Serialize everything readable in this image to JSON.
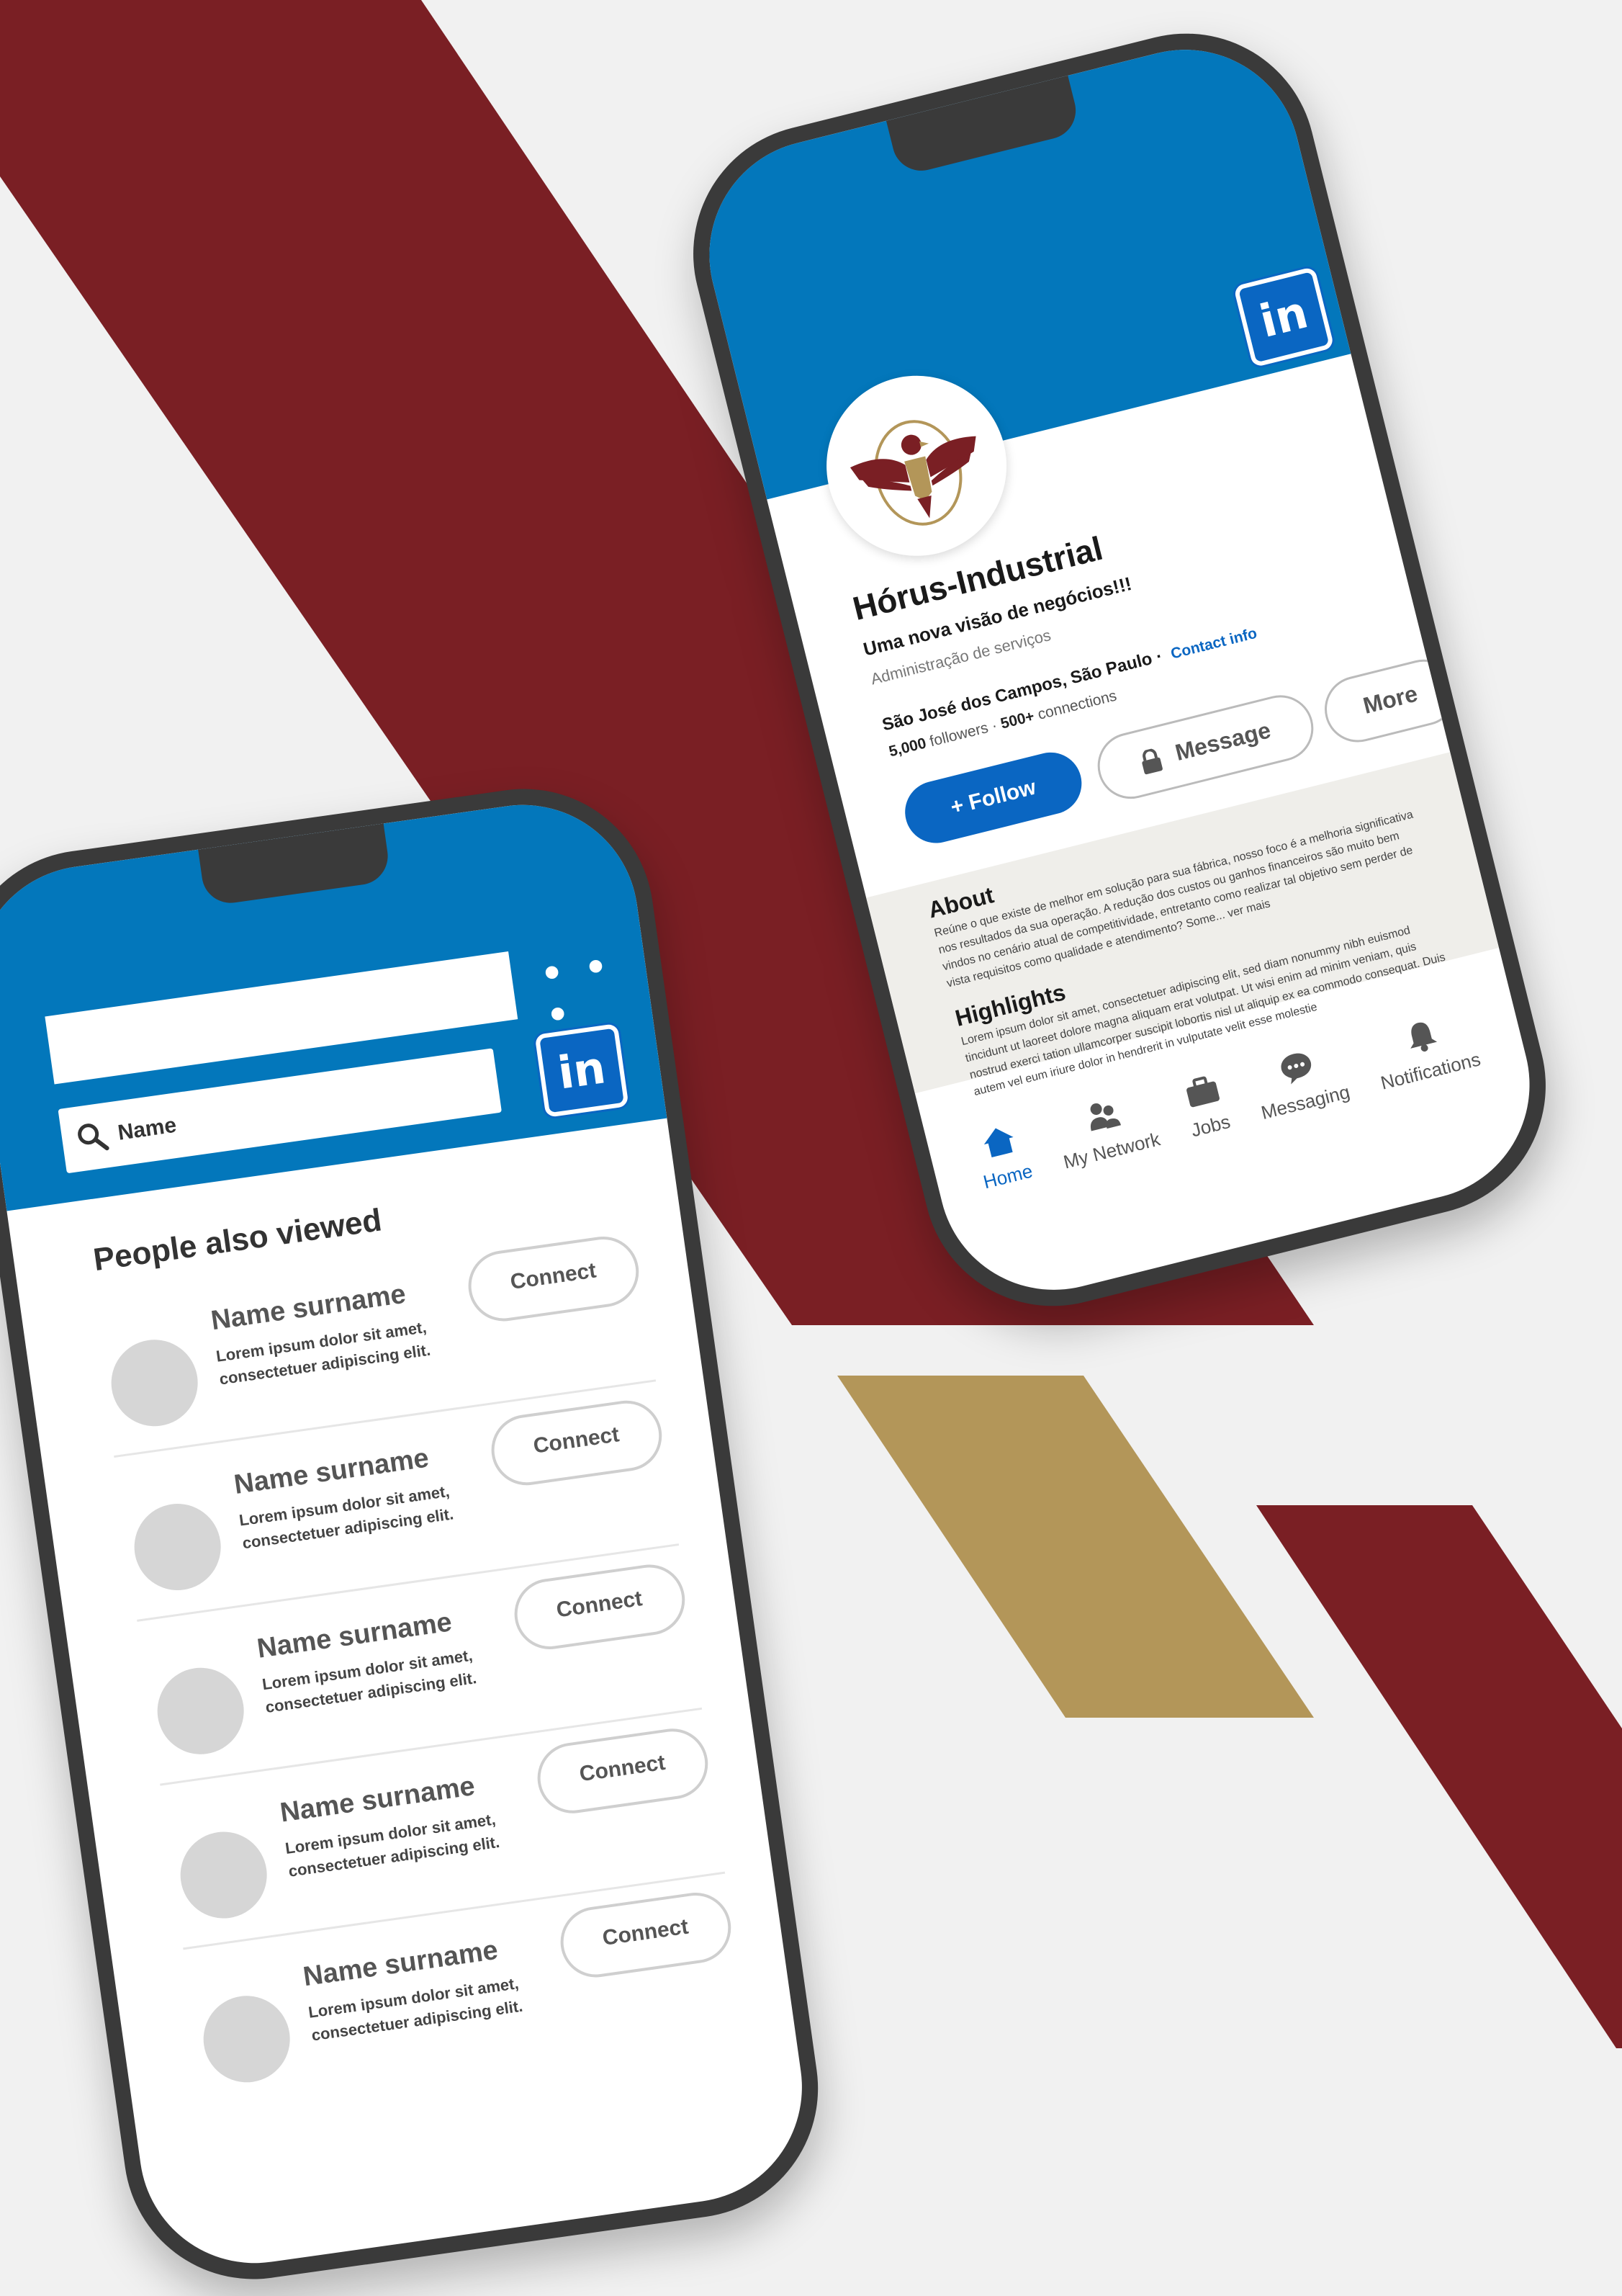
{
  "colors": {
    "maroon": "#7a1f24",
    "gold": "#b39659",
    "linkedin_blue": "#0377bb",
    "background": "#f1f1f1"
  },
  "profile": {
    "company_name": "Hórus-Industrial",
    "tagline": "Uma nova visão de negócios!!!",
    "industry": "Administração de serviços",
    "location": "São José dos Campos, São Paulo ·",
    "contact_link": "Contact info",
    "followers_count": "5,000",
    "followers_label": "followers ·",
    "connections_count": "500+",
    "connections_label": "connections",
    "follow_label": "+ Follow",
    "message_label": "Message",
    "more_label": "More",
    "about_title": "About",
    "about_text": "Reúne o que existe de melhor em solução para sua fábrica, nosso foco é a melhoria significativa nos resultados da sua operação. A redução dos custos ou ganhos financeiros são muito bem vindos no cenário atual de competitividade, entretanto como realizar tal objetivo sem perder de vista requisitos como qualidade e atendimento? Some... ver mais",
    "highlights_title": "Highlights",
    "highlights_text": "Lorem ipsum dolor sit amet, consectetuer adipiscing elit, sed diam nonummy nibh euismod tincidunt ut laoreet dolore magna aliquam erat volutpat. Ut wisi enim ad minim veniam, quis nostrud exerci tation ullamcorper suscipit lobortis nisl ut aliquip ex ea commodo consequat. Duis autem vel eum iriure dolor in hendrerit in vulputate velit esse molestie",
    "linkedin_logo": "in",
    "nav": [
      {
        "label": "Home",
        "icon": "home-icon"
      },
      {
        "label": "My Network",
        "icon": "network-icon"
      },
      {
        "label": "Jobs",
        "icon": "briefcase-icon"
      },
      {
        "label": "Messaging",
        "icon": "message-icon"
      },
      {
        "label": "Notifications",
        "icon": "bell-icon"
      }
    ]
  },
  "list_phone": {
    "more_dots": "• • •",
    "search_placeholder": "Name",
    "linkedin_logo": "in",
    "section_title": "People also viewed",
    "people": [
      {
        "name": "Name surname",
        "desc": "Lorem ipsum dolor sit amet, consectetuer adipiscing elit.",
        "button": "Connect"
      },
      {
        "name": "Name surname",
        "desc": "Lorem ipsum dolor sit amet, consectetuer adipiscing elit.",
        "button": "Connect"
      },
      {
        "name": "Name surname",
        "desc": "Lorem ipsum dolor sit amet, consectetuer adipiscing elit.",
        "button": "Connect"
      },
      {
        "name": "Name surname",
        "desc": "Lorem ipsum dolor sit amet, consectetuer adipiscing elit.",
        "button": "Connect"
      },
      {
        "name": "Name surname",
        "desc": "Lorem ipsum dolor sit amet, consectetuer adipiscing elit.",
        "button": "Connect"
      }
    ]
  }
}
